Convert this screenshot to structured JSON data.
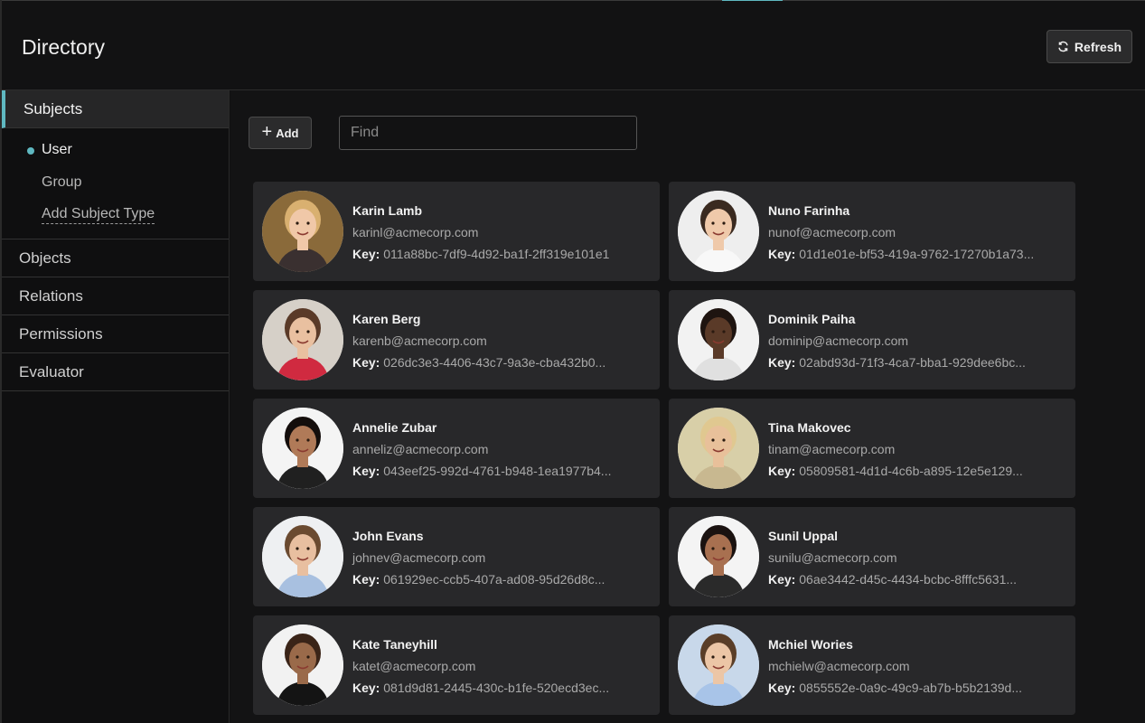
{
  "header": {
    "title": "Directory",
    "refresh_label": "Refresh"
  },
  "sidebar": {
    "sections": [
      {
        "label": "Subjects",
        "active": true
      },
      {
        "label": "Objects"
      },
      {
        "label": "Relations"
      },
      {
        "label": "Permissions"
      },
      {
        "label": "Evaluator"
      }
    ],
    "subject_types": [
      {
        "label": "User",
        "selected": true
      },
      {
        "label": "Group"
      },
      {
        "label": "Add Subject Type"
      }
    ]
  },
  "toolbar": {
    "add_label": "Add",
    "find_placeholder": "Find"
  },
  "key_label": "Key:",
  "users": [
    {
      "name": "Karin Lamb",
      "email": "karinl@acmecorp.com",
      "key": "011a88bc-7df9-4d92-ba1f-2ff319e101e1",
      "bg": "#8a6a3a",
      "skin": "#f0c8a8",
      "hair": "#d9b070",
      "shirt": "#3a3030"
    },
    {
      "name": "Nuno Farinha",
      "email": "nunof@acmecorp.com",
      "key": "01d1e01e-bf53-419a-9762-17270b1a73...",
      "bg": "#eeeeee",
      "skin": "#efc9aa",
      "hair": "#3a2a20",
      "shirt": "#f8f8f8"
    },
    {
      "name": "Karen Berg",
      "email": "karenb@acmecorp.com",
      "key": "026dc3e3-4406-43c7-9a3e-cba432b0...",
      "bg": "#d6d0c8",
      "skin": "#e9c0a0",
      "hair": "#5a3a28",
      "shirt": "#d02a40"
    },
    {
      "name": "Dominik Paiha",
      "email": "dominip@acmecorp.com",
      "key": "02abd93d-71f3-4ca7-bba1-929dee6bc...",
      "bg": "#f2f2f2",
      "skin": "#5a3a28",
      "hair": "#1e1410",
      "shirt": "#e0e0e0"
    },
    {
      "name": "Annelie Zubar",
      "email": "anneliz@acmecorp.com",
      "key": "043eef25-992d-4761-b948-1ea1977b4...",
      "bg": "#f4f4f4",
      "skin": "#b07a58",
      "hair": "#140e0c",
      "shirt": "#202020"
    },
    {
      "name": "Tina Makovec",
      "email": "tinam@acmecorp.com",
      "key": "05809581-4d1d-4c6b-a895-12e5e129...",
      "bg": "#d8cfa8",
      "skin": "#e8c09a",
      "hair": "#e0c890",
      "shirt": "#c8b890"
    },
    {
      "name": "John Evans",
      "email": "johnev@acmecorp.com",
      "key": "061929ec-ccb5-407a-ad08-95d26d8c...",
      "bg": "#eef0f2",
      "skin": "#e8bfa0",
      "hair": "#6a4a30",
      "shirt": "#a8c0e0"
    },
    {
      "name": "Sunil Uppal",
      "email": "sunilu@acmecorp.com",
      "key": "06ae3442-d45c-4434-bcbc-8fffc5631...",
      "bg": "#f4f4f4",
      "skin": "#a87050",
      "hair": "#1a1210",
      "shirt": "#2a2a2a"
    },
    {
      "name": "Kate Taneyhill",
      "email": "katet@acmecorp.com",
      "key": "081d9d81-2445-430c-b1fe-520ecd3ec...",
      "bg": "#f2f2f2",
      "skin": "#9a6a4a",
      "hair": "#3a2418",
      "shirt": "#141414"
    },
    {
      "name": "Mchiel Wories",
      "email": "mchielw@acmecorp.com",
      "key": "0855552e-0a9c-49c9-ab7b-b5b2139d...",
      "bg": "#c8d8ea",
      "skin": "#ecc6a6",
      "hair": "#5a3e28",
      "shirt": "#a8c4e8"
    }
  ]
}
